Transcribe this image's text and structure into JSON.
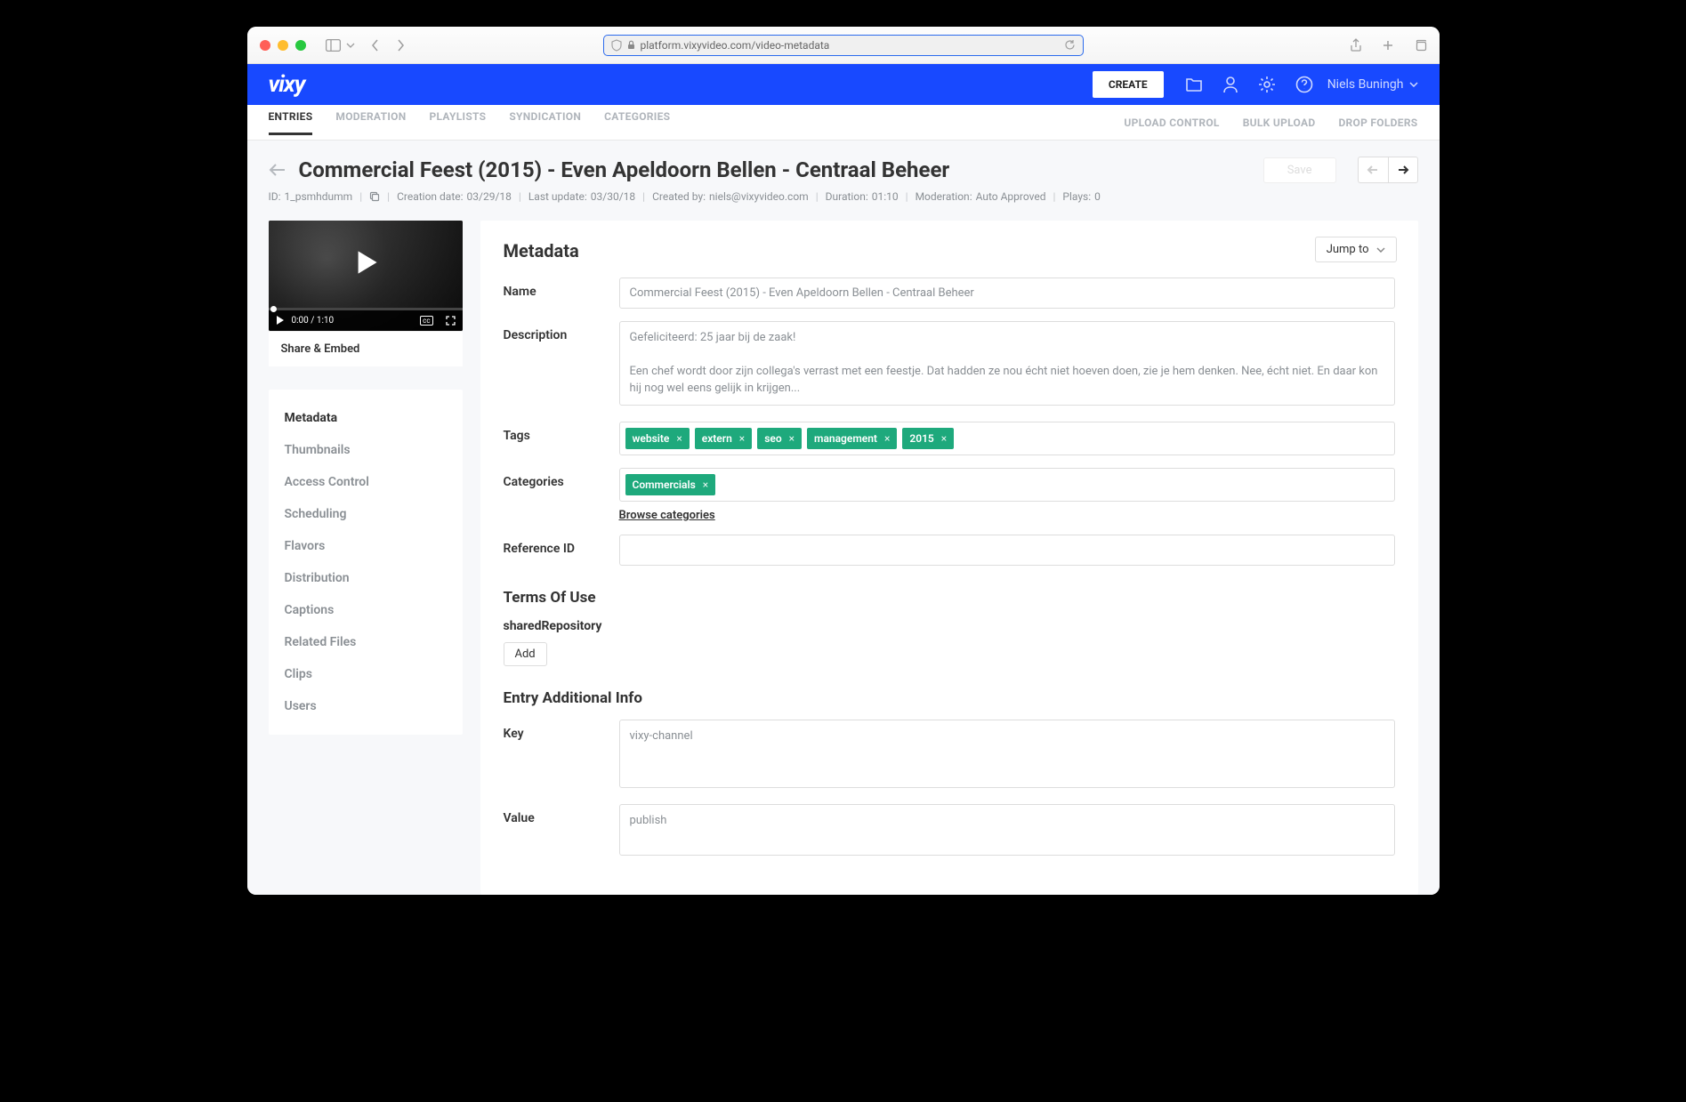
{
  "browser": {
    "url": "platform.vixyvideo.com/video-metadata"
  },
  "topbar": {
    "logo": "vixy",
    "create_label": "CREATE",
    "username": "Niels Buningh"
  },
  "subnav": {
    "left": [
      "ENTRIES",
      "MODERATION",
      "PLAYLISTS",
      "SYNDICATION",
      "CATEGORIES"
    ],
    "right": [
      "UPLOAD CONTROL",
      "BULK UPLOAD",
      "DROP FOLDERS"
    ],
    "active": "ENTRIES"
  },
  "page": {
    "title": "Commercial Feest (2015) - Even Apeldoorn Bellen - Centraal Beheer",
    "save_label": "Save",
    "meta": {
      "id_label": "ID:",
      "id": "1_psmhdumm",
      "creation_label": "Creation date:",
      "creation": "03/29/18",
      "update_label": "Last update:",
      "update": "03/30/18",
      "created_by_label": "Created by:",
      "created_by": "niels@vixyvideo.com",
      "duration_label": "Duration:",
      "duration": "01:10",
      "moderation_label": "Moderation:",
      "moderation": "Auto Approved",
      "plays_label": "Plays:",
      "plays": "0"
    }
  },
  "player": {
    "time": "0:00 / 1:10",
    "share_embed": "Share & Embed"
  },
  "side_nav": [
    "Metadata",
    "Thumbnails",
    "Access Control",
    "Scheduling",
    "Flavors",
    "Distribution",
    "Captions",
    "Related Files",
    "Clips",
    "Users"
  ],
  "side_nav_active": "Metadata",
  "main": {
    "jump_to": "Jump to",
    "section_metadata": "Metadata",
    "name_label": "Name",
    "name_value": "Commercial Feest (2015) - Even Apeldoorn Bellen - Centraal Beheer",
    "desc_label": "Description",
    "desc_value": "Gefeliciteerd: 25 jaar bij de zaak!\n\nEen chef wordt door zijn collega's verrast met een feestje. Dat hadden ze nou écht niet hoeven doen, zie je hem denken. Nee, écht niet. En daar kon hij nog wel eens gelijk in krijgen...",
    "tags_label": "Tags",
    "tags": [
      "website",
      "extern",
      "seo",
      "management",
      "2015"
    ],
    "categories_label": "Categories",
    "categories": [
      "Commercials"
    ],
    "browse_categories": "Browse categories",
    "reference_label": "Reference ID",
    "reference_value": "",
    "section_terms": "Terms Of Use",
    "shared_repo_label": "sharedRepository",
    "add_label": "Add",
    "section_additional": "Entry Additional Info",
    "key_label": "Key",
    "key_value": "vixy-channel",
    "value_label": "Value",
    "value_value": "publish"
  }
}
